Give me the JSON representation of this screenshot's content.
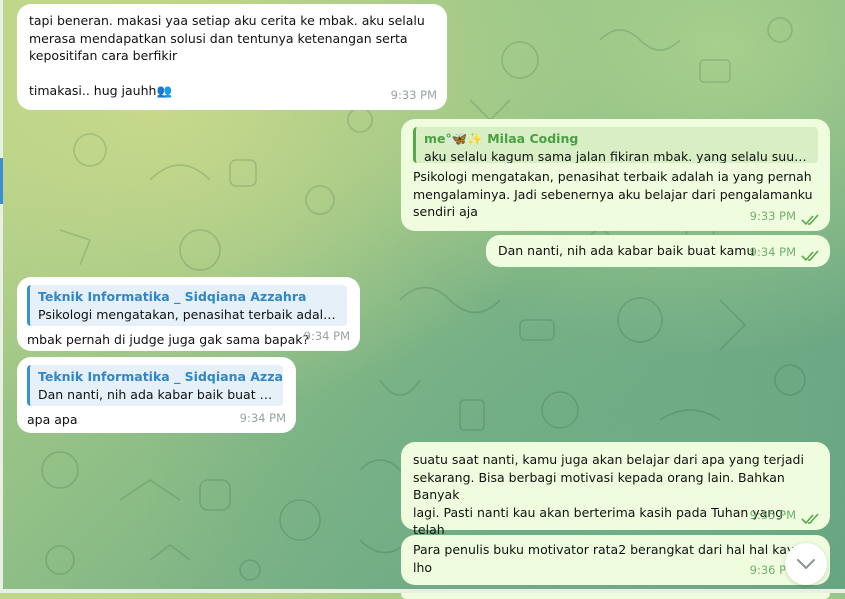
{
  "messages": {
    "m1": {
      "text": "tapi beneran. makasi yaa setiap aku cerita ke mbak. aku selalu\nmerasa mendapatkan solusi dan tentunya ketenangan serta\nkepositifan cara berfikir\n\ntimakasi.. hug jauhh",
      "emoji": "👥",
      "time": "9:33 PM"
    },
    "m2": {
      "reply_name": "me°🦋✨ Milaa Coding",
      "reply_snippet": "aku selalu kagum sama jalan fikiran mbak. yang selalu suudzon ...",
      "text": "Psikologi mengatakan, penasihat terbaik adalah ia yang pernah\nmengalaminya. Jadi sebenernya aku belajar dari pengalamanku\nsendiri aja",
      "time": "9:33 PM"
    },
    "m3": {
      "text": "Dan nanti, nih ada kabar baik buat kamu",
      "time": "9:34 PM"
    },
    "m4": {
      "reply_name": "Teknik Informatika _ Sidqiana Azzahra",
      "reply_snippet": "Psikologi mengatakan, penasihat terbaik adalah i...",
      "text": "mbak pernah di judge juga gak sama bapak?",
      "time": "9:34 PM"
    },
    "m5": {
      "reply_name": "Teknik Informatika _ Sidqiana Azzahra",
      "reply_snippet": "Dan nanti, nih ada kabar baik buat ka...",
      "text": "apa apa",
      "time": "9:34 PM"
    },
    "m6": {
      "text": "suatu saat nanti, kamu juga akan belajar dari apa yang terjadi\nsekarang. Bisa berbagi motivasi kepada orang lain. Bahkan Banyak\nlagi. Pasti nanti kau akan berterima kasih pada Tuhan yang telah\nmenciptakan skenario ini",
      "time": "9:35 PM"
    },
    "m7": {
      "text": "Para penulis buku motivator rata2 berangkat dari hal hal kayak s\nlho",
      "time": "9:36 PM"
    }
  },
  "icons": {
    "read_receipt": "double-check-icon",
    "scroll_down": "chevron-down-icon"
  },
  "colors": {
    "incoming_bubble": "#ffffff",
    "outgoing_bubble": "#effdde",
    "accent_blue": "#3a8fd0",
    "accent_green": "#4a9f43"
  }
}
